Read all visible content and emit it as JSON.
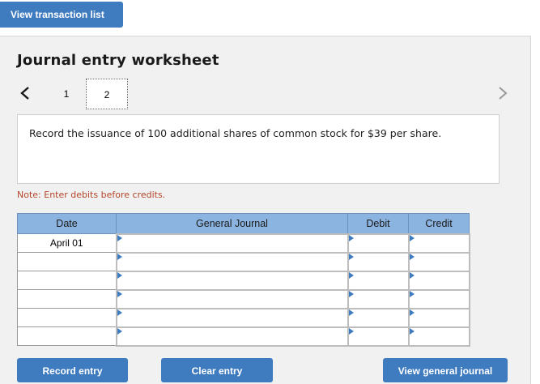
{
  "header": {
    "view_transaction_list_label": "View transaction list"
  },
  "worksheet": {
    "title": "Journal entry worksheet",
    "pages": [
      "1",
      "2"
    ],
    "current_page": "2",
    "instruction": "Record the issuance of 100 additional shares of common stock for $39 per share.",
    "note": "Note: Enter debits before credits."
  },
  "table": {
    "headers": {
      "date": "Date",
      "general_journal": "General Journal",
      "debit": "Debit",
      "credit": "Credit"
    },
    "rows": [
      {
        "date": "April 01",
        "account": "",
        "debit": "",
        "credit": ""
      },
      {
        "date": "",
        "account": "",
        "debit": "",
        "credit": ""
      },
      {
        "date": "",
        "account": "",
        "debit": "",
        "credit": ""
      },
      {
        "date": "",
        "account": "",
        "debit": "",
        "credit": ""
      },
      {
        "date": "",
        "account": "",
        "debit": "",
        "credit": ""
      },
      {
        "date": "",
        "account": "",
        "debit": "",
        "credit": ""
      }
    ]
  },
  "buttons": {
    "record_entry": "Record entry",
    "clear_entry": "Clear entry",
    "view_general_journal": "View general journal"
  },
  "icons": {
    "prev": "chevron-left-icon",
    "next": "chevron-right-icon"
  },
  "colors": {
    "accent": "#3f7bbf",
    "header_bg": "#8cb4e0",
    "note": "#b5462a",
    "panel_bg": "#f1f1f1"
  }
}
